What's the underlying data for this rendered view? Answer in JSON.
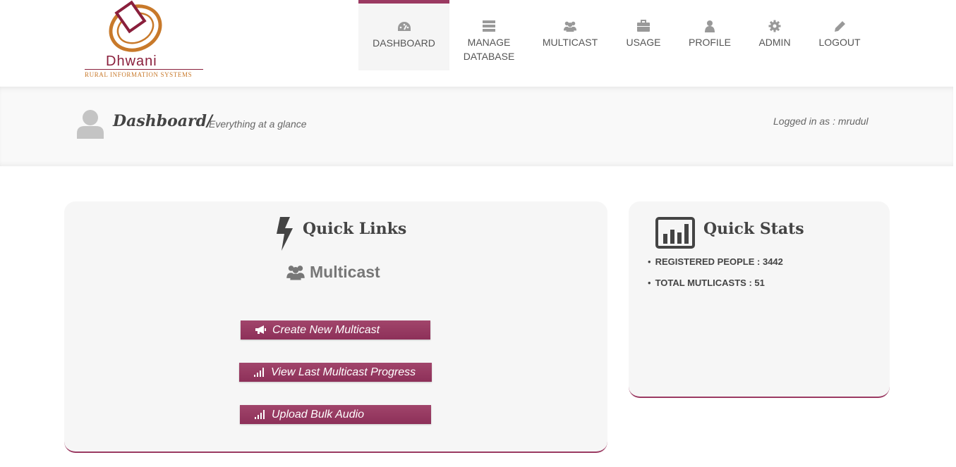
{
  "logo": {
    "name": "Dhwani",
    "tagline": "RURAL INFORMATION SYSTEMS"
  },
  "nav": {
    "items": [
      {
        "label": "DASHBOARD",
        "icon": "dashboard-icon",
        "active": true
      },
      {
        "label": "MANAGE\nDATABASE",
        "icon": "database-icon",
        "active": false
      },
      {
        "label": "MULTICAST",
        "icon": "group-icon",
        "active": false
      },
      {
        "label": "USAGE",
        "icon": "briefcase-icon",
        "active": false
      },
      {
        "label": "PROFILE",
        "icon": "user-icon",
        "active": false
      },
      {
        "label": "ADMIN",
        "icon": "gear-icon",
        "active": false
      },
      {
        "label": "LOGOUT",
        "icon": "pencil-icon",
        "active": false
      }
    ]
  },
  "header": {
    "title": "Dashboard/",
    "subtitle": "Everything at a glance",
    "logged_in": "Logged in as : mrudul"
  },
  "quick_links": {
    "heading": "Quick Links",
    "section": "Multicast",
    "buttons": [
      {
        "label": "Create New Multicast",
        "icon": "megaphone-icon"
      },
      {
        "label": "View Last Multicast Progress",
        "icon": "signal-icon"
      },
      {
        "label": "Upload Bulk Audio",
        "icon": "signal-icon"
      }
    ]
  },
  "quick_stats": {
    "heading": "Quick Stats",
    "items": [
      "REGISTERED PEOPLE : 3442",
      "TOTAL MUTLICASTS : 51"
    ]
  },
  "colors": {
    "accent": "#9b3a62",
    "logo_red": "#8a1f3c",
    "logo_orange": "#c8792a",
    "panel_bg": "#f6f6f6"
  }
}
